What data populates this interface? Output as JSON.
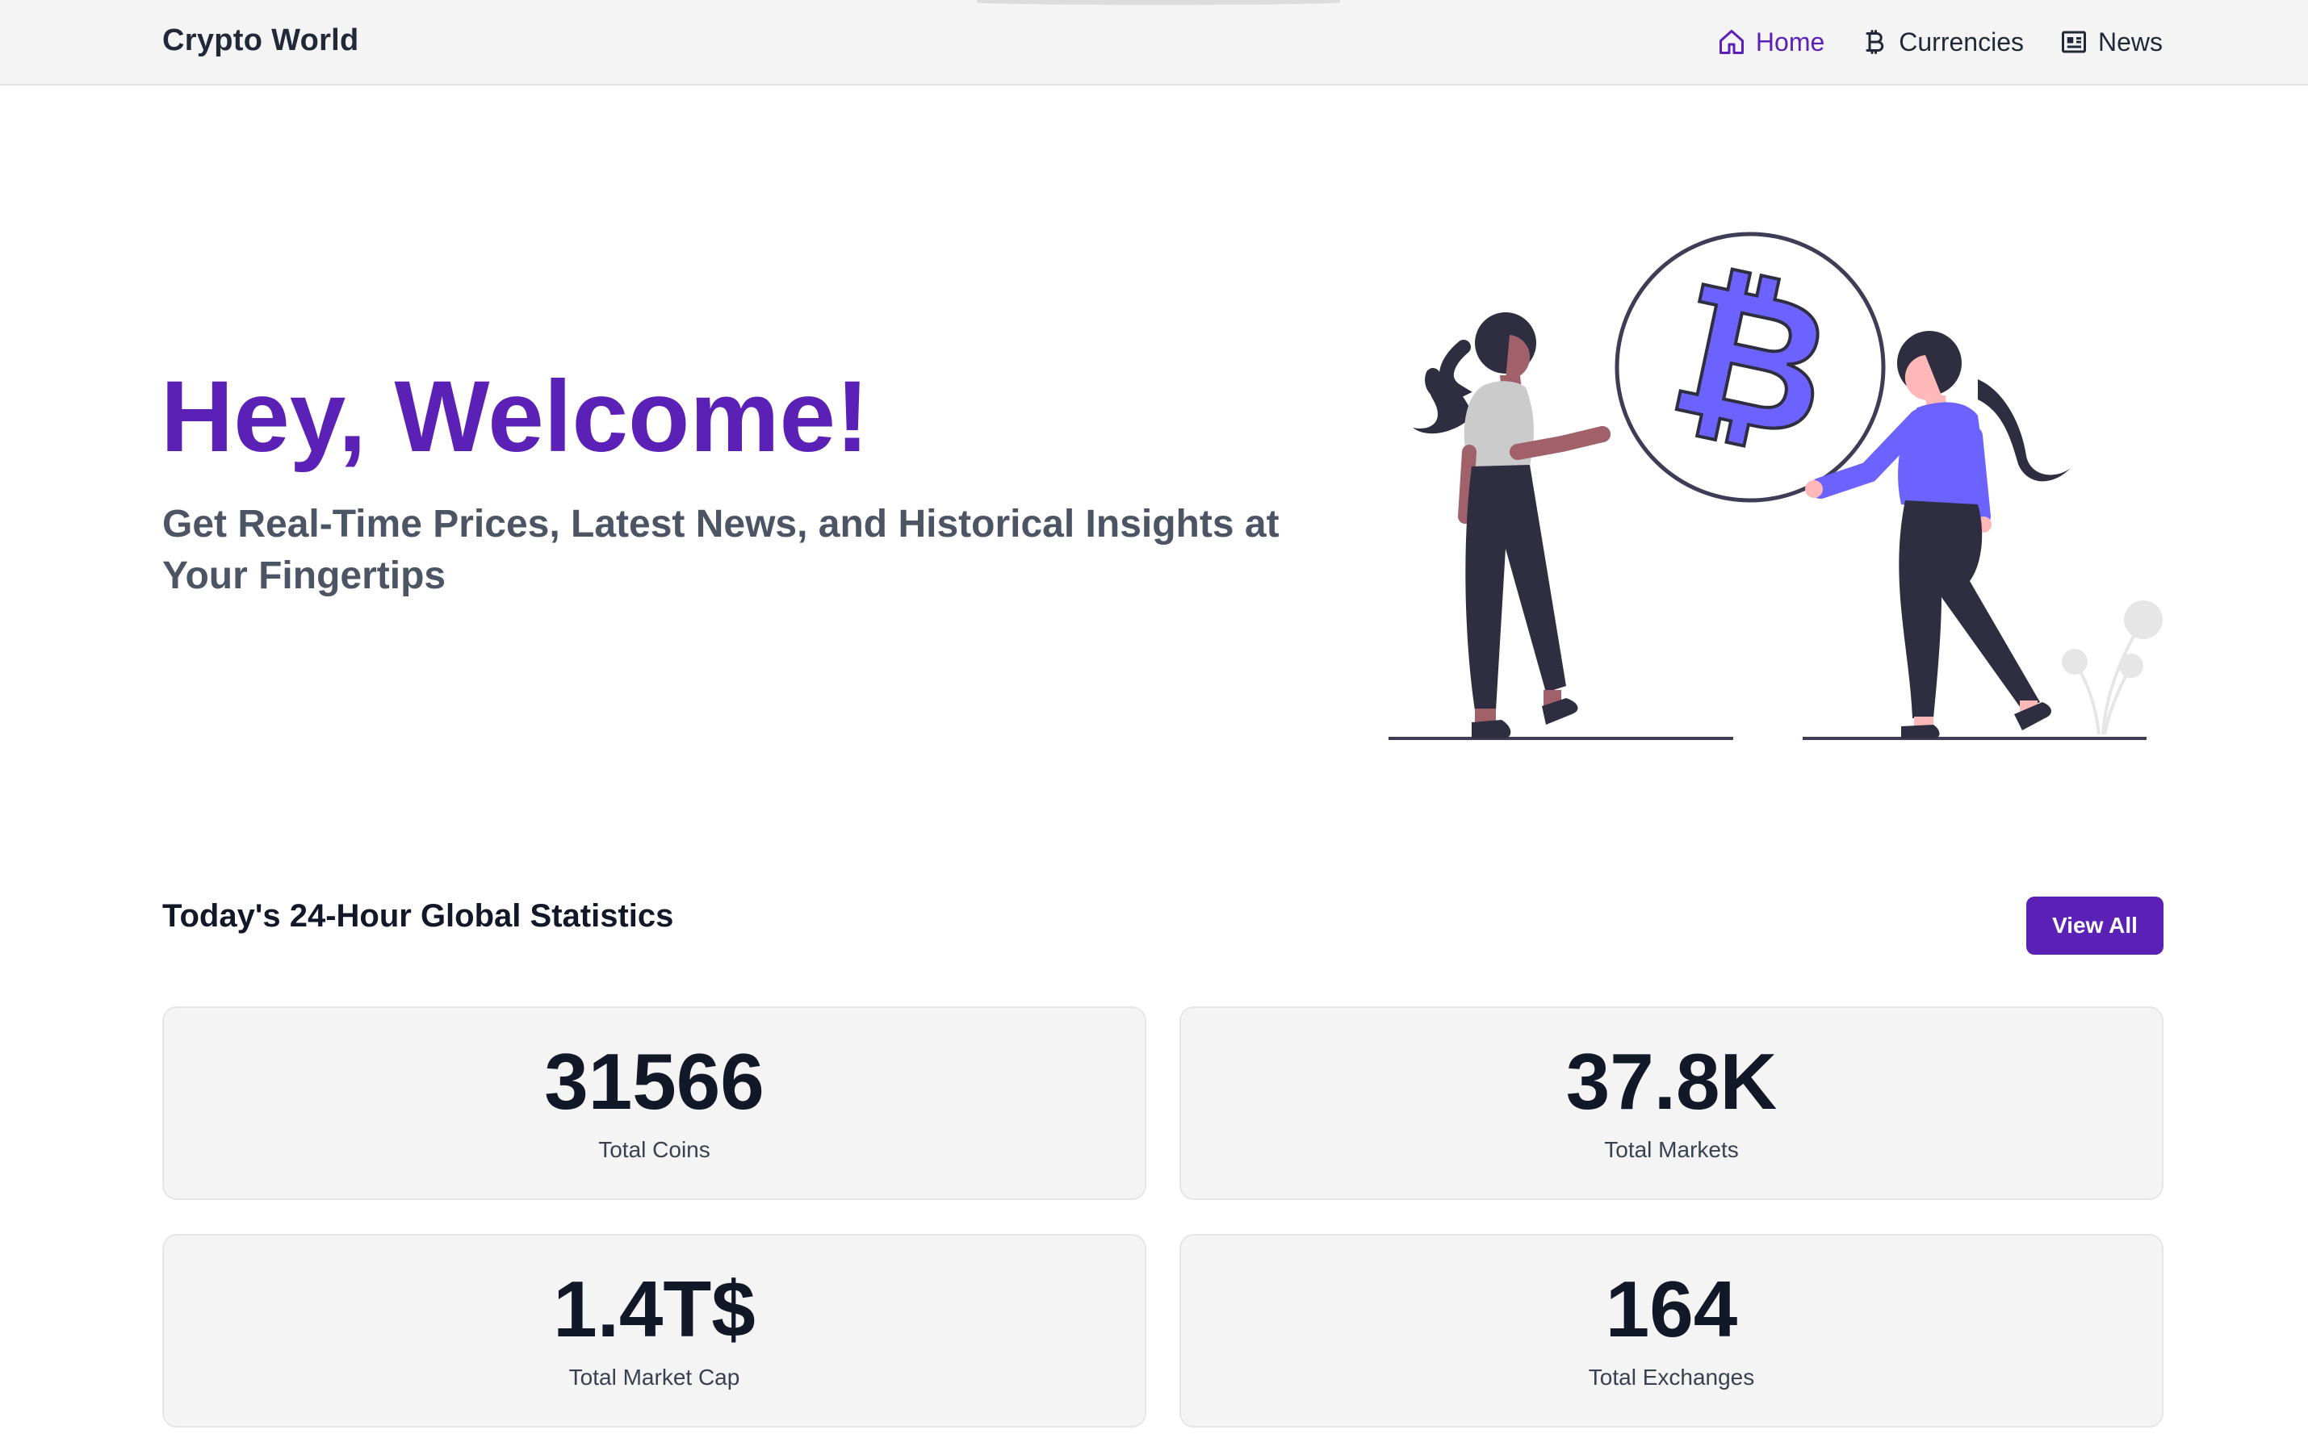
{
  "navbar": {
    "brand": "Crypto World",
    "links": [
      {
        "label": "Home",
        "icon": "home-icon",
        "active": true
      },
      {
        "label": "Currencies",
        "icon": "bitcoin-icon",
        "active": false
      },
      {
        "label": "News",
        "icon": "newspaper-icon",
        "active": false
      }
    ]
  },
  "hero": {
    "title": "Hey, Welcome!",
    "subtitle": "Get Real-Time Prices, Latest News, and Historical Insights at Your Fingertips",
    "illustration": "two-people-holding-bitcoin-coin"
  },
  "stats": {
    "title": "Today's 24-Hour Global Statistics",
    "view_all_label": "View All",
    "cards": [
      {
        "value": "31566",
        "label": "Total Coins"
      },
      {
        "value": "37.8K",
        "label": "Total Markets"
      },
      {
        "value": "1.4T$",
        "label": "Total Market Cap"
      },
      {
        "value": "164",
        "label": "Total Exchanges"
      }
    ]
  },
  "colors": {
    "accent": "#5b21b6",
    "illustration_purple": "#6c63ff",
    "dark": "#2f2e41",
    "card_bg": "#f4f4f4"
  }
}
